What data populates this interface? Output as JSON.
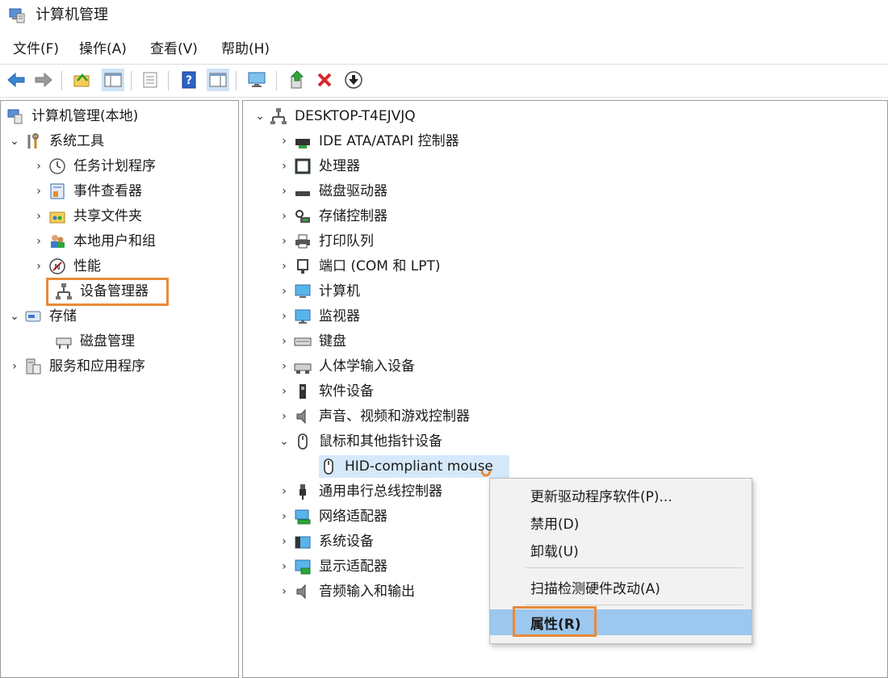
{
  "window": {
    "title": "计算机管理"
  },
  "menu": [
    "文件(F)",
    "操作(A)",
    "查看(V)",
    "帮助(H)"
  ],
  "left_tree": {
    "root": "计算机管理(本地)",
    "system_tools": "系统工具",
    "task_scheduler": "任务计划程序",
    "event_viewer": "事件查看器",
    "shared_folders": "共享文件夹",
    "local_users": "本地用户和组",
    "performance": "性能",
    "device_manager": "设备管理器",
    "storage": "存储",
    "disk_management": "磁盘管理",
    "services_apps": "服务和应用程序"
  },
  "device_tree": {
    "computer": "DESKTOP-T4EJVJQ",
    "categories": [
      "IDE ATA/ATAPI 控制器",
      "处理器",
      "磁盘驱动器",
      "存储控制器",
      "打印队列",
      "端口 (COM 和 LPT)",
      "计算机",
      "监视器",
      "键盘",
      "人体学输入设备",
      "软件设备",
      "声音、视频和游戏控制器",
      "鼠标和其他指针设备"
    ],
    "mouse_device": "HID-compliant mouse",
    "categories_after": [
      "通用串行总线控制器",
      "网络适配器",
      "系统设备",
      "显示适配器",
      "音频输入和输出"
    ]
  },
  "context_menu": {
    "update_driver": "更新驱动程序软件(P)...",
    "disable": "禁用(D)",
    "uninstall": "卸载(U)",
    "scan": "扫描检测硬件改动(A)",
    "properties": "属性(R)"
  }
}
